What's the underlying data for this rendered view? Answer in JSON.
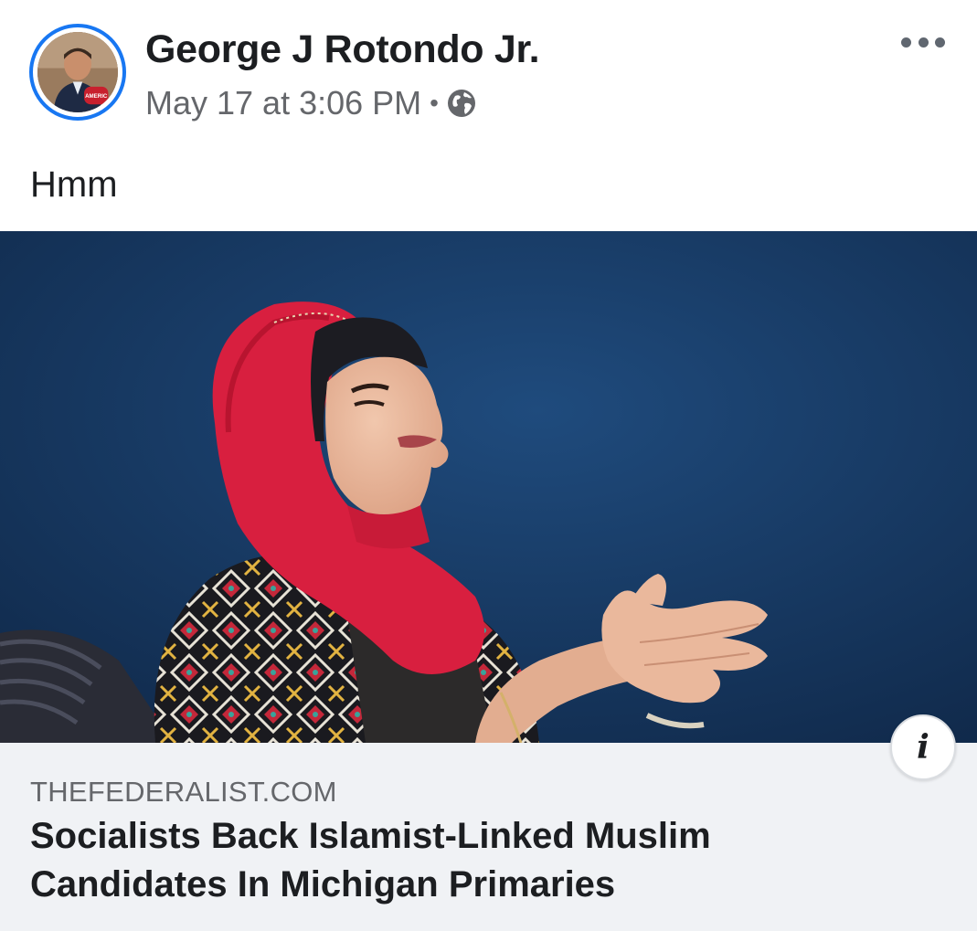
{
  "post": {
    "author": "George J Rotondo Jr.",
    "timestamp": "May 17 at 3:06 PM",
    "separator": "•",
    "privacy_icon": "globe-icon",
    "more_icon": "more-options-icon",
    "text": "Hmm"
  },
  "avatar": {
    "badge_text": "AMERIC"
  },
  "link": {
    "domain": "THEFEDERALIST.COM",
    "title": "Socialists Back Islamist-Linked Muslim Candidates In Michigan Primaries",
    "info_label": "i"
  },
  "colors": {
    "accent": "#1877f2",
    "text_primary": "#1c1e21",
    "text_secondary": "#65676b",
    "link_footer_bg": "#f0f2f5",
    "image_bg": "#173a66",
    "hijab": "#d81f3f"
  }
}
